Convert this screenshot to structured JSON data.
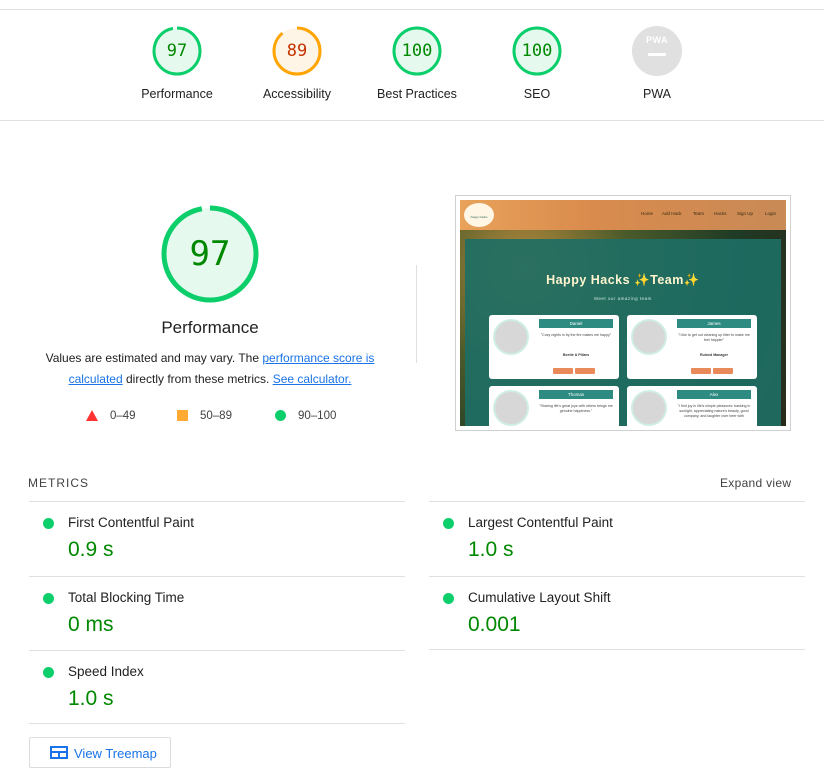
{
  "gauges": [
    {
      "score": "97",
      "label": "Performance",
      "status": "pass",
      "fraction": 0.97,
      "color": "#0cce6b"
    },
    {
      "score": "89",
      "label": "Accessibility",
      "status": "average",
      "fraction": 0.89,
      "color": "#ffa400"
    },
    {
      "score": "100",
      "label": "Best Practices",
      "status": "pass",
      "fraction": 1.0,
      "color": "#0cce6b"
    },
    {
      "score": "100",
      "label": "SEO",
      "status": "pass",
      "fraction": 1.0,
      "color": "#0cce6b"
    },
    {
      "label": "PWA",
      "badge": "PWA",
      "status": "not-applicable"
    }
  ],
  "performance": {
    "score": "97",
    "fraction": 0.97,
    "title": "Performance",
    "desc_prefix": "Values are estimated and may vary. The ",
    "desc_link1": "performance score is calculated",
    "desc_middle": " directly from these metrics. ",
    "desc_link2": "See calculator."
  },
  "legend": [
    {
      "shape": "triangle",
      "range": "0–49",
      "color": "#ff3333"
    },
    {
      "shape": "square",
      "range": "50–89",
      "color": "#ffaa33"
    },
    {
      "shape": "circle",
      "range": "90–100",
      "color": "#0cce6b"
    }
  ],
  "screenshot": {
    "logo_text": "happy hacks",
    "nav_items": [
      "Home",
      "Add Hack",
      "Team",
      "Hacks",
      "Sign Up",
      "Login"
    ],
    "heading": "Happy Hacks ✨Team✨",
    "subheading": "Meet our amazing team",
    "cards": [
      {
        "name": "Daniel",
        "quote": "\"Cozy nights in by the fire makes me happy\"",
        "role": "Beetle & Pillars"
      },
      {
        "name": "James",
        "quote": "\"I like to get out cleaning up litter to make me feel happier\"",
        "role": "Ruined Manager"
      },
      {
        "name": "Thomas",
        "quote": "\"Sharing life's great joys with others brings me genuine happiness.\"",
        "role": ""
      },
      {
        "name": "Alex",
        "quote": "\"I find joy in life's simple pleasures: basking in sunlight, appreciating nature's beauty, good company, and laughter over beer with",
        "role": ""
      }
    ]
  },
  "metrics": {
    "title": "METRICS",
    "expand_label": "Expand view",
    "left": [
      {
        "name": "First Contentful Paint",
        "value": "0.9 s"
      },
      {
        "name": "Total Blocking Time",
        "value": "0 ms"
      },
      {
        "name": "Speed Index",
        "value": "1.0 s"
      }
    ],
    "right": [
      {
        "name": "Largest Contentful Paint",
        "value": "1.0 s"
      },
      {
        "name": "Cumulative Layout Shift",
        "value": "0.001"
      }
    ]
  },
  "treemap": {
    "label": "View Treemap"
  },
  "colors": {
    "pass": "#0cce6b",
    "pass_text": "#008800",
    "average": "#ffa400",
    "average_text": "#c33300",
    "link": "#1a73e8"
  }
}
